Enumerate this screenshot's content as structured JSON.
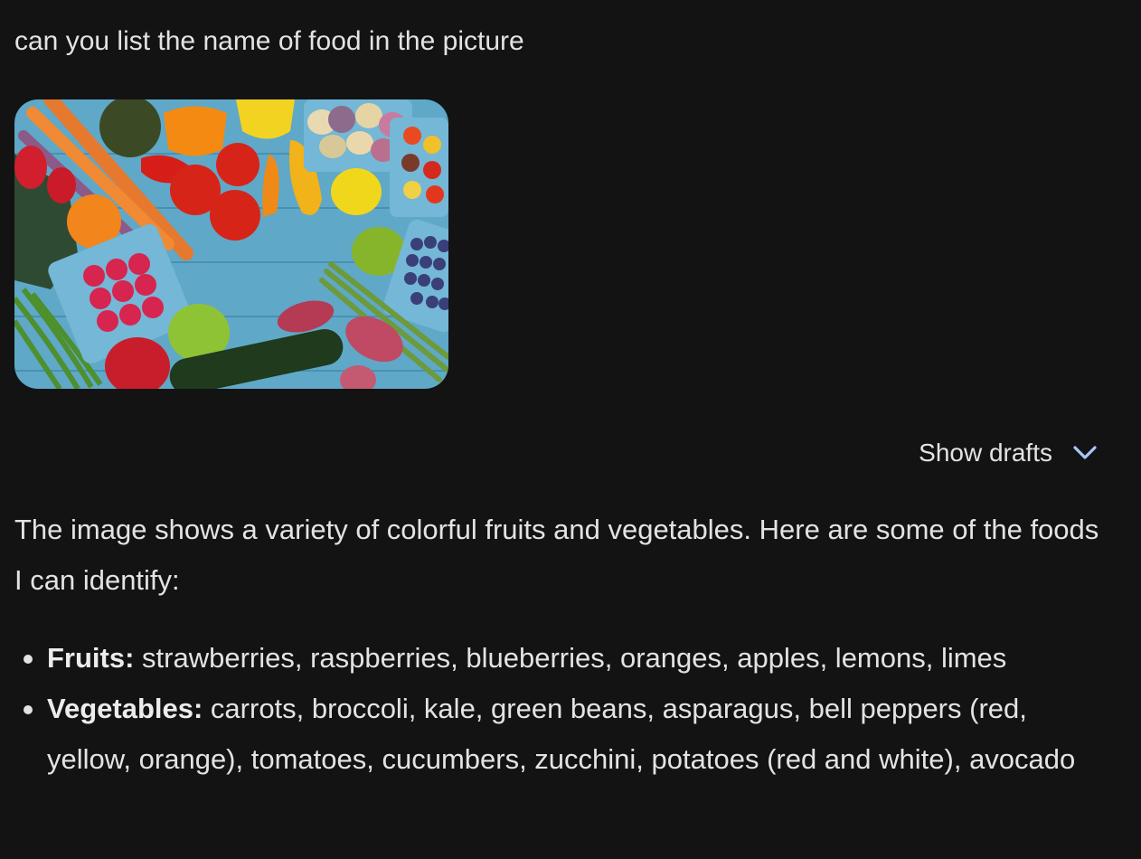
{
  "conversation": {
    "user_prompt": "can you list the name of food in the picture",
    "drafts": {
      "label": "Show drafts",
      "icon": "chevron-down-icon"
    },
    "response": {
      "intro": "The image shows a variety of colorful fruits and vegetables. Here are some of the foods I can identify:",
      "items": [
        {
          "heading": "Fruits:",
          "text": " strawberries, raspberries, blueberries, oranges, apples, lemons, limes"
        },
        {
          "heading": "Vegetables:",
          "text": " carrots, broccoli, kale, green beans, asparagus, bell peppers (red, yellow, orange), tomatoes, cucumbers, zucchini, potatoes (red and white), avocado"
        }
      ]
    }
  },
  "colors": {
    "background": "#131314",
    "text": "#e3e3e3",
    "accent_chevron": "#a8c7fa"
  }
}
